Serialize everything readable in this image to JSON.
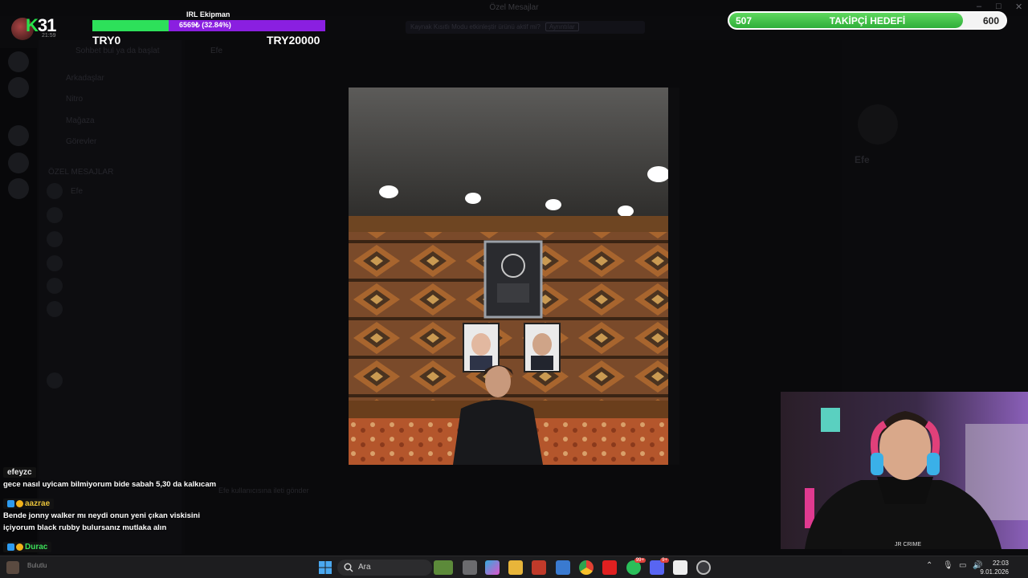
{
  "window": {
    "title": "Özel Mesajlar",
    "minimize": "–",
    "maximize": "□",
    "close": "✕"
  },
  "background_app": {
    "banner_text": "Kaynak Kısıtlı Modu etkinleştir ürünü aktif mi?",
    "banner_action": "Ayrıntılar",
    "sidebar_items": [
      "Arkadaşlar",
      "Nitro",
      "Mağaza",
      "Görevler"
    ],
    "section_label": "ÖZEL MESAJLAR",
    "dm_label": "Efe",
    "chat_header": "Efe",
    "chat_input": "Efe kullanıcısına ileti gönder",
    "profile_name": "Efe",
    "profile_search": "Sohbet bul ya da başlat"
  },
  "overlay": {
    "logo_k": "K",
    "logo_num": "31",
    "logo_time": "21:59",
    "goal_title": "IRL Ekipman",
    "goal_percent_text": "6569₺ (32.84%)",
    "goal_fraction": 0.3284,
    "goal_min": "TRY0",
    "goal_max": "TRY20000",
    "follower_current": "507",
    "follower_label": "TAKİPÇİ HEDEFİ",
    "follower_max": "600",
    "follower_fraction": 0.845
  },
  "chat": [
    {
      "user": "efeyzc",
      "color": "#e8e8e8",
      "badges": [],
      "message": "gece nasıl uyicam bilmiyorum bide sabah 5,30 da kalkıcam"
    },
    {
      "user": "aazrae",
      "color": "#e8c23a",
      "badges": [
        "#2d9bf0",
        "#f2b21a"
      ],
      "message": "Bende jonny walker mı neydi onun yeni çıkan viskisini içiyorum black rubby bulursanız mutlaka alın"
    },
    {
      "user": "Durac",
      "color": "#3ce05a",
      "badges": [
        "#2d9bf0",
        "#f2b21a"
      ],
      "message": ""
    }
  ],
  "taskbar": {
    "weather": "Bulutlu",
    "search_placeholder": "Ara",
    "app_icons": [
      "files-icon",
      "task-view-icon",
      "copilot-icon",
      "explorer-icon",
      "news-icon",
      "store-icon",
      "chrome-icon",
      "youtube-icon",
      "whatsapp-icon",
      "discord-icon",
      "capcut-icon",
      "obs-icon"
    ],
    "whatsapp_badge": "99+",
    "discord_badge": "9+",
    "time": "22:03",
    "date": "9.01.2026"
  },
  "webcam_text": "JR CRIME"
}
